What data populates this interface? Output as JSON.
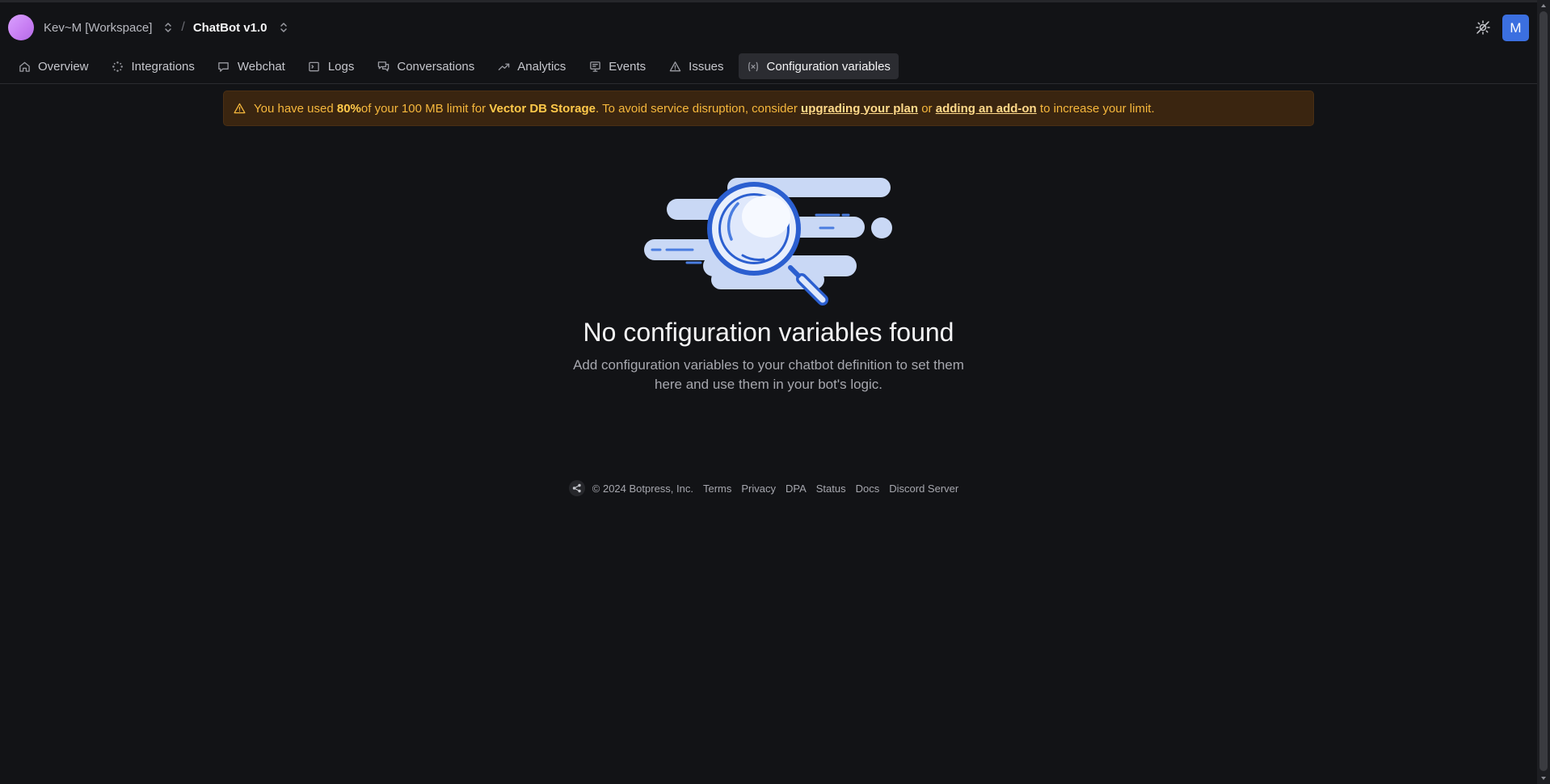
{
  "header": {
    "workspace_name": "Kev~M [Workspace]",
    "separator": "/",
    "bot_name": "ChatBot v1.0",
    "user_initial": "M"
  },
  "tabs": [
    {
      "label": "Overview",
      "icon": "home-icon"
    },
    {
      "label": "Integrations",
      "icon": "integrations-icon"
    },
    {
      "label": "Webchat",
      "icon": "chat-bubble-icon"
    },
    {
      "label": "Logs",
      "icon": "terminal-icon"
    },
    {
      "label": "Conversations",
      "icon": "conversations-icon"
    },
    {
      "label": "Analytics",
      "icon": "trend-icon"
    },
    {
      "label": "Events",
      "icon": "monitor-icon"
    },
    {
      "label": "Issues",
      "icon": "warning-icon"
    },
    {
      "label": "Configuration variables",
      "icon": "variable-icon",
      "active": true
    }
  ],
  "banner": {
    "p1": "You have used ",
    "percent": "80%",
    "p2": " of your 100 MB limit for ",
    "resource": "Vector DB Storage",
    "p3": ". To avoid service disruption, consider ",
    "link1": "upgrading your plan",
    "p4": " or ",
    "link2": "adding an add-on",
    "p5": " to increase your limit."
  },
  "empty_state": {
    "title": "No configuration variables found",
    "description": "Add configuration variables to your chatbot definition to set them here and use them in your bot's logic."
  },
  "footer": {
    "copyright": "© 2024 Botpress, Inc.",
    "links": [
      "Terms",
      "Privacy",
      "DPA",
      "Status",
      "Docs",
      "Discord Server"
    ]
  },
  "colors": {
    "background": "#121316",
    "accent": "#3b6fe0",
    "warning_bg": "#3a2510",
    "warning_text": "#f6b73c"
  }
}
